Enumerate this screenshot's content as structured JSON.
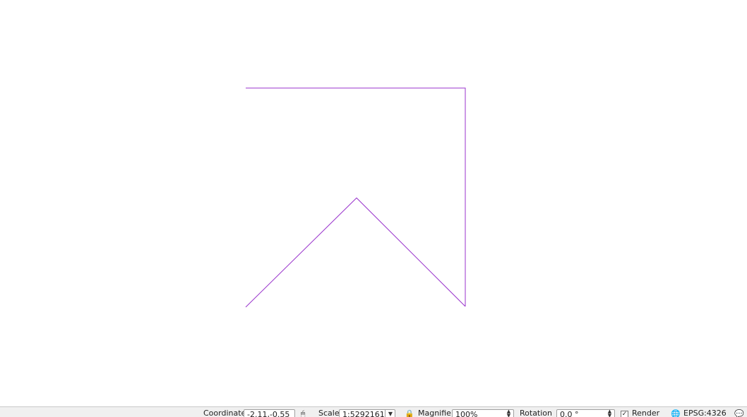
{
  "map": {
    "background": "#ffffff",
    "line_color": "#9933cc"
  },
  "status_bar": {
    "coordinate_label": "Coordinate",
    "coordinate_value": "-2.11,-0.55",
    "scale_label": "Scale",
    "scale_value": "1:5292161",
    "magnifier_label": "Magnifier",
    "magnifier_value": "100%",
    "rotation_label": "Rotation",
    "rotation_value": "0.0 °",
    "render_label": "Render",
    "render_checked": true,
    "crs_label": "EPSG:4326"
  }
}
